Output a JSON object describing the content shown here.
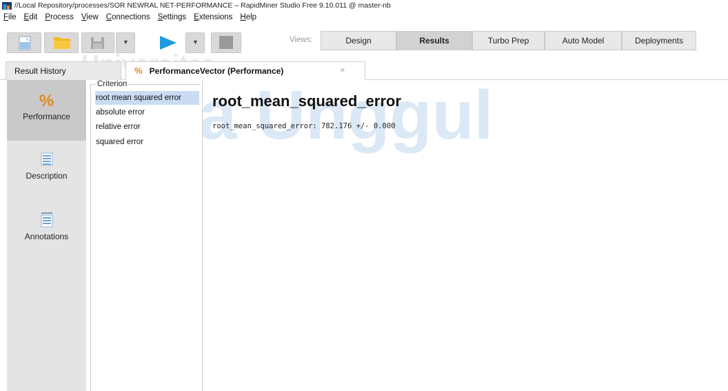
{
  "window": {
    "title": "//Local Repository/processes/SOR NEWRAL NET-PERFORMANCE – RapidMiner Studio Free 9.10.011 @ master-nb"
  },
  "menu": {
    "items": [
      "File",
      "Edit",
      "Process",
      "View",
      "Connections",
      "Settings",
      "Extensions",
      "Help"
    ]
  },
  "views": {
    "label": "Views:",
    "tabs": [
      "Design",
      "Results",
      "Turbo Prep",
      "Auto Model",
      "Deployments"
    ],
    "active": "Results"
  },
  "tabs": {
    "result_history": "Result History",
    "performance": "PerformanceVector (Performance)",
    "close": "×"
  },
  "sidebar": {
    "items": [
      "Performance",
      "Description",
      "Annotations"
    ],
    "active": "Performance"
  },
  "criterion": {
    "legend": "Criterion",
    "items": [
      "root mean squared error",
      "absolute error",
      "relative error",
      "squared error"
    ],
    "selected": "root mean squared error"
  },
  "main": {
    "heading": "root_mean_squared_error",
    "value": "root_mean_squared_error: 782.176 +/- 0.000"
  },
  "watermark": {
    "line1": "Universitas",
    "line2": "sa Unggul"
  },
  "colors": {
    "play": "#1e9be0",
    "folder": "#f5b81c",
    "selection": "#c9dcf3",
    "percent": "#e08a1e"
  }
}
